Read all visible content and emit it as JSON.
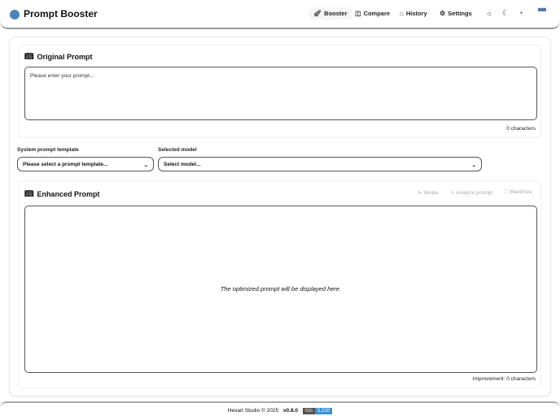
{
  "header": {
    "title": "Prompt Booster",
    "nav": [
      {
        "label": "Booster",
        "icon": "rocket-icon"
      },
      {
        "label": "Compare",
        "icon": "compare-icon"
      },
      {
        "label": "History",
        "icon": "history-icon"
      },
      {
        "label": "Settings",
        "icon": "gear-icon"
      }
    ]
  },
  "original": {
    "title": "Original Prompt",
    "placeholder": "Please enter your prompt...",
    "count": "0 characters"
  },
  "template": {
    "label": "System prompt template",
    "value": "Please select a prompt template..."
  },
  "model": {
    "label": "Selected model",
    "value": "Select model..."
  },
  "enhanced": {
    "title": "Enhanced Prompt",
    "iterate": "Iterate",
    "analyze": "Analyze prompt",
    "maximize": "Maximize",
    "placeholder": "The optimized prompt will be displayed here.",
    "improvement": "Improvement: 0 characters"
  },
  "footer": {
    "copyright": "Hexart Studio © 2025",
    "version": "v0.8.0",
    "hits_label": "hits",
    "hits": "5,220"
  }
}
